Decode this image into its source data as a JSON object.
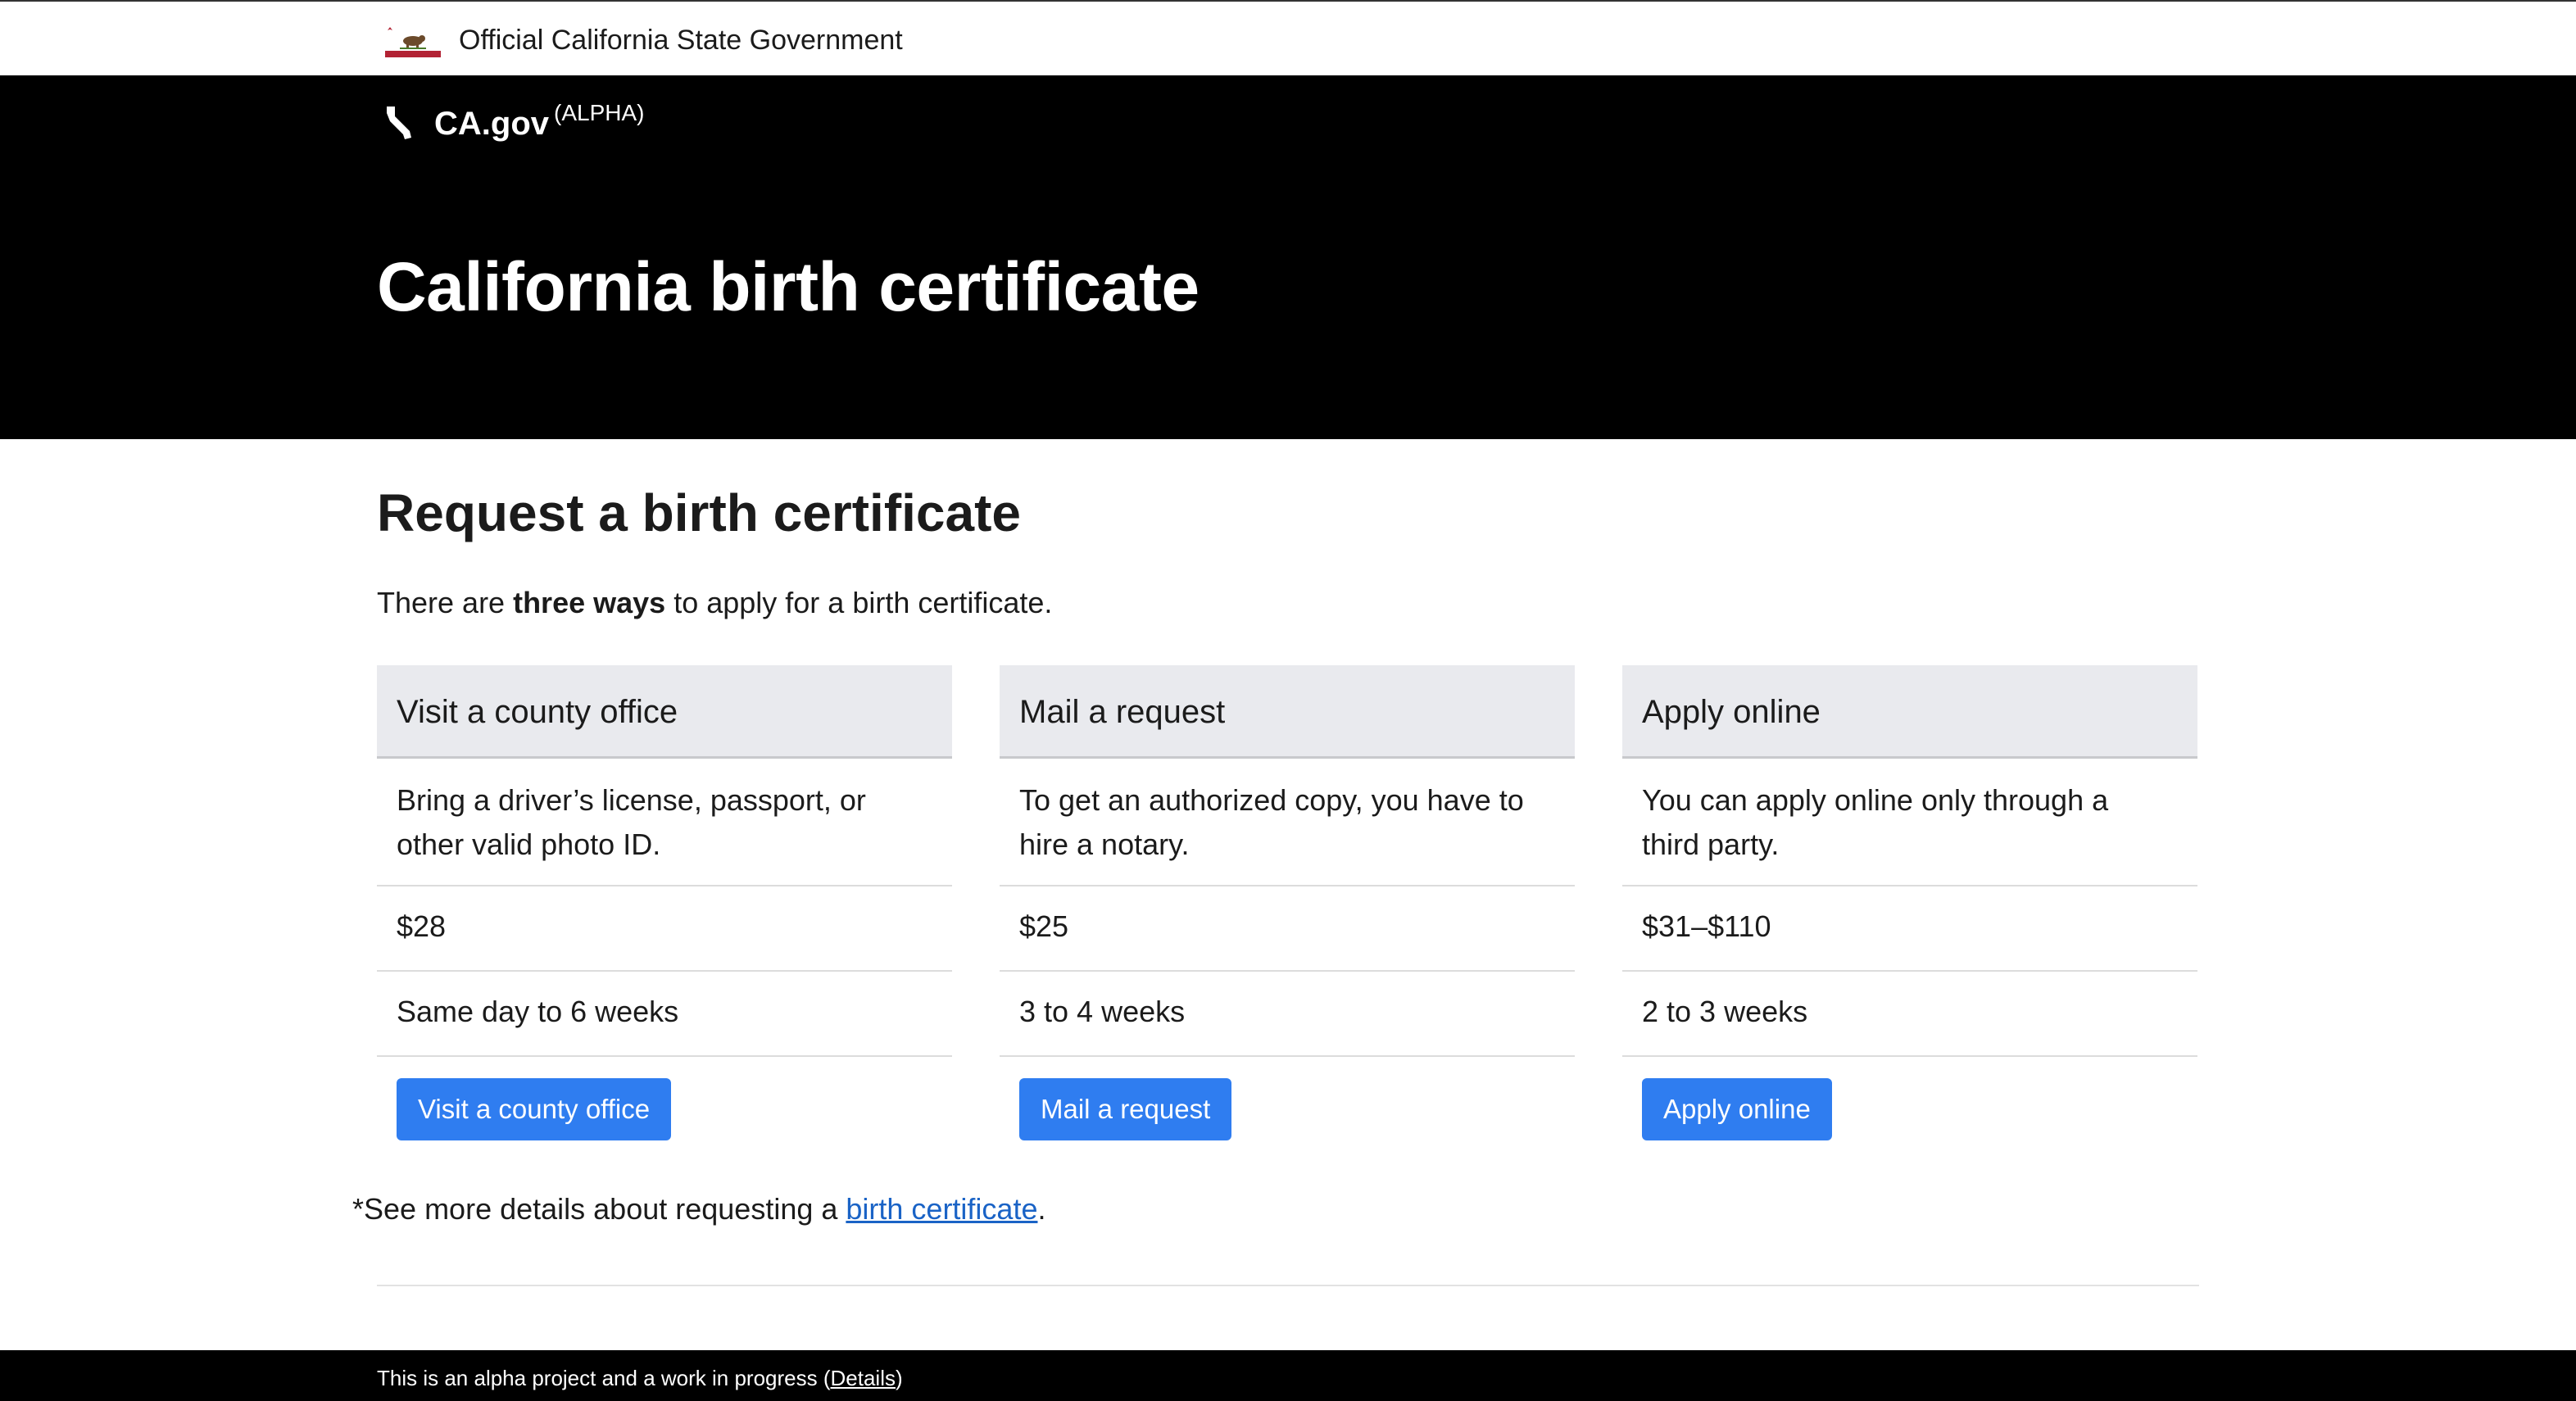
{
  "official_banner": {
    "text": "Official California State Government",
    "flag_icon": "california-flag-icon"
  },
  "header": {
    "logo_icon": "california-state-icon",
    "logo_text": "CA.gov",
    "logo_badge": "(ALPHA)",
    "title": "California birth certificate"
  },
  "main": {
    "heading": "Request a birth certificate",
    "intro_prefix": "There are ",
    "intro_bold": "three ways",
    "intro_suffix": " to apply for a birth certificate.",
    "cards": [
      {
        "title": "Visit a county office",
        "description": "Bring a driver’s license, passport, or other valid photo ID.",
        "price": "$28",
        "time": "Same day to 6 weeks",
        "button": "Visit a county office"
      },
      {
        "title": "Mail a request",
        "description": "To get an authorized copy, you have to hire a notary.",
        "price": "$25",
        "time": "3 to 4 weeks",
        "button": "Mail a request"
      },
      {
        "title": "Apply online",
        "description": "You can apply online only through a third party.",
        "price": "$31–$110",
        "time": "2 to 3 weeks",
        "button": "Apply online"
      }
    ],
    "note_prefix": "*See more details about requesting a ",
    "note_link": "birth certificate",
    "note_suffix": "."
  },
  "footer": {
    "text_prefix": "This is an alpha project and a work in progress (",
    "link": "Details",
    "text_suffix": ")"
  },
  "colors": {
    "header_bg": "#000000",
    "card_head_bg": "#e9eaee",
    "button_bg": "#2f7df0",
    "link": "#1a63c6"
  }
}
